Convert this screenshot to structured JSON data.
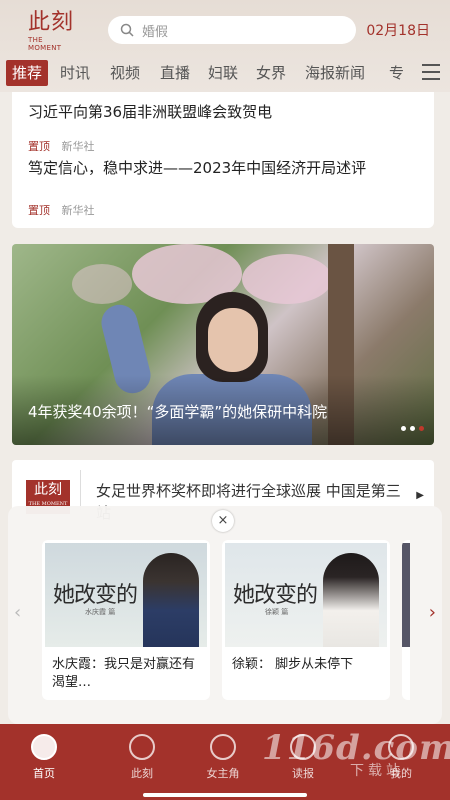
{
  "header": {
    "logo_cn": "此刻",
    "logo_en": "THE MOMENT",
    "search_placeholder": "婚假",
    "date": "02月18日"
  },
  "tabs": [
    "推荐",
    "时讯",
    "视频",
    "直播",
    "妇联",
    "女界",
    "海报新闻",
    "专"
  ],
  "news": [
    {
      "title": "习近平向第36届非洲联盟峰会致贺电",
      "pin": "置顶",
      "source": "新华社"
    },
    {
      "title": "笃定信心，稳中求进——2023年中国经济开局述评",
      "pin": "置顶",
      "source": "新华社"
    }
  ],
  "banner": {
    "caption": "4年获奖40余项！“多面学霸”的她保研中科院",
    "slides": 3,
    "active_slide": 3
  },
  "ticker": {
    "logo_cn": "此刻",
    "logo_en": "THE MOMENT",
    "text": "女足世界杯奖杯即将进行全球巡展 中国是第三站"
  },
  "popup": {
    "close": "×",
    "prev": "‹",
    "next": "›",
    "videos": [
      {
        "thumb_title": "她改变的",
        "thumb_sub": "水庆霞 篇",
        "caption": "水庆霞：我只是对赢还有渴望…"
      },
      {
        "thumb_title": "她改变的",
        "thumb_sub": "徐颖 篇",
        "caption": "徐颖： 脚步从未停下"
      }
    ]
  },
  "bottom_nav": [
    {
      "label": "首页",
      "icon": "home-icon",
      "active": true
    },
    {
      "label": "此刻",
      "icon": "moment-icon",
      "active": false
    },
    {
      "label": "女主角",
      "icon": "heroine-icon",
      "active": false
    },
    {
      "label": "读报",
      "icon": "newspaper-icon",
      "active": false
    },
    {
      "label": "我的",
      "icon": "profile-icon",
      "active": false
    }
  ],
  "watermark": {
    "main": "116d.com",
    "sub": "下载站"
  },
  "colors": {
    "brand": "#a3322b",
    "background": "#f0ece7"
  }
}
